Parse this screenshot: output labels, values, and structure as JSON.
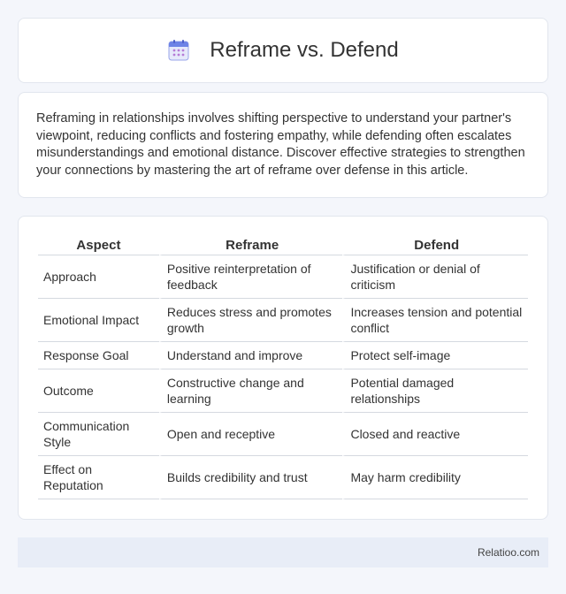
{
  "header": {
    "title": "Reframe vs. Defend",
    "icon": "calendar-icon"
  },
  "intro": {
    "text": "Reframing in relationships involves shifting perspective to understand your partner's viewpoint, reducing conflicts and fostering empathy, while defending often escalates misunderstandings and emotional distance. Discover effective strategies to strengthen your connections by mastering the art of reframe over defense in this article."
  },
  "table": {
    "headers": [
      "Aspect",
      "Reframe",
      "Defend"
    ],
    "rows": [
      [
        "Approach",
        "Positive reinterpretation of feedback",
        "Justification or denial of criticism"
      ],
      [
        "Emotional Impact",
        "Reduces stress and promotes growth",
        "Increases tension and potential conflict"
      ],
      [
        "Response Goal",
        "Understand and improve",
        "Protect self-image"
      ],
      [
        "Outcome",
        "Constructive change and learning",
        "Potential damaged relationships"
      ],
      [
        "Communication Style",
        "Open and receptive",
        "Closed and reactive"
      ],
      [
        "Effect on Reputation",
        "Builds credibility and trust",
        "May harm credibility"
      ]
    ]
  },
  "footer": {
    "site": "Relatioo.com"
  }
}
